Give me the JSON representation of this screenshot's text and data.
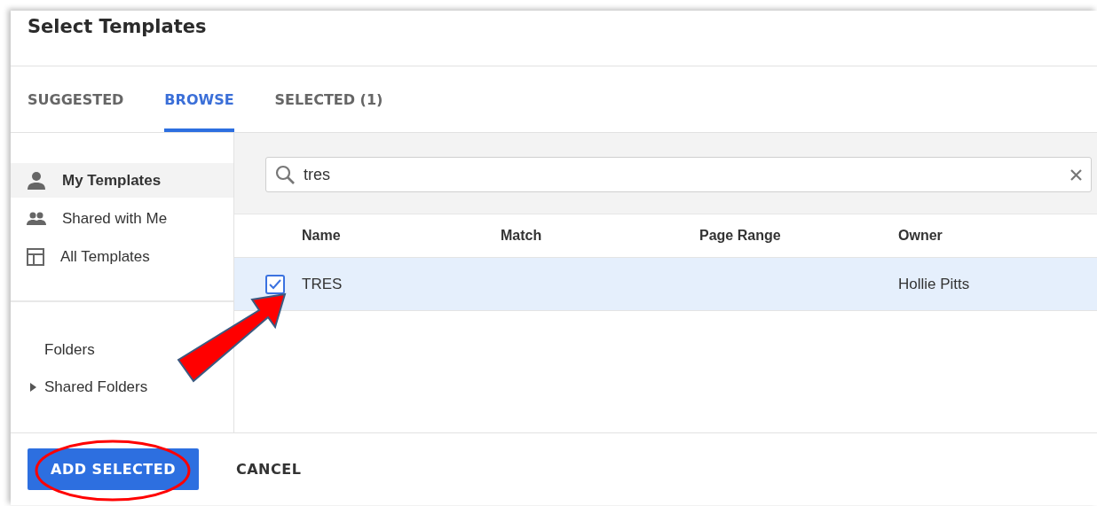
{
  "dialog": {
    "title": "Select Templates"
  },
  "tabs": [
    {
      "label": "SUGGESTED",
      "selected": false
    },
    {
      "label": "BROWSE",
      "selected": true
    },
    {
      "label": "SELECTED (1)",
      "selected": false
    }
  ],
  "sidebar": {
    "items": [
      {
        "label": "My Templates",
        "selected": true
      },
      {
        "label": "Shared with Me",
        "selected": false
      },
      {
        "label": "All Templates",
        "selected": false
      }
    ],
    "folders": {
      "label": "Folders",
      "children": [
        {
          "label": "Shared Folders",
          "expanded": false
        }
      ]
    }
  },
  "search": {
    "value": "tres"
  },
  "table": {
    "columns": [
      "Name",
      "Match",
      "Page Range",
      "Owner"
    ],
    "rows": [
      {
        "checked": true,
        "selected": true,
        "cells": [
          "TRES",
          "",
          "",
          "Hollie Pitts"
        ]
      }
    ]
  },
  "buttons": [
    {
      "label": "ADD SELECTED",
      "kind": "primary"
    },
    {
      "label": "CANCEL",
      "kind": "text"
    }
  ],
  "annotations": {
    "arrow": {
      "color": "#ff0000"
    },
    "ellipse": {
      "color": "#ff0000"
    }
  }
}
